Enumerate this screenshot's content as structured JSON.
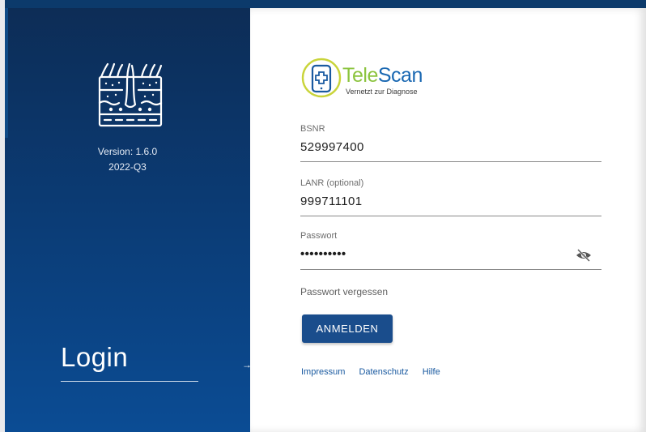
{
  "sidebar": {
    "version": "Version: 1.6.0",
    "release": "2022-Q3",
    "title": "Login",
    "arrow": "→"
  },
  "brand": {
    "name_part1": "Tele",
    "name_part2": "Scan",
    "tagline": "Vernetzt zur Diagnose",
    "colors": {
      "tele": "#8cc43f",
      "scan": "#1a68b2"
    }
  },
  "form": {
    "bsnr": {
      "label": "BSNR",
      "value": "529997400"
    },
    "lanr": {
      "label": "LANR (optional)",
      "value": "999711101"
    },
    "password": {
      "label": "Passwort",
      "value": "••••••••••"
    },
    "forgot": "Passwort vergessen",
    "submit": "ANMELDEN"
  },
  "footer": {
    "links": [
      "Impressum",
      "Datenschutz",
      "Hilfe"
    ]
  },
  "icons": {
    "skin_logo": "skin-hair-follicle-icon",
    "eye": "eye-off-icon",
    "brand_logo": "tablet-cross-icon"
  },
  "colors": {
    "sidebar_top": "#0d2c55",
    "sidebar_bottom": "#0b4c94",
    "button": "#1a4d8c",
    "link": "#1a5aa0"
  }
}
